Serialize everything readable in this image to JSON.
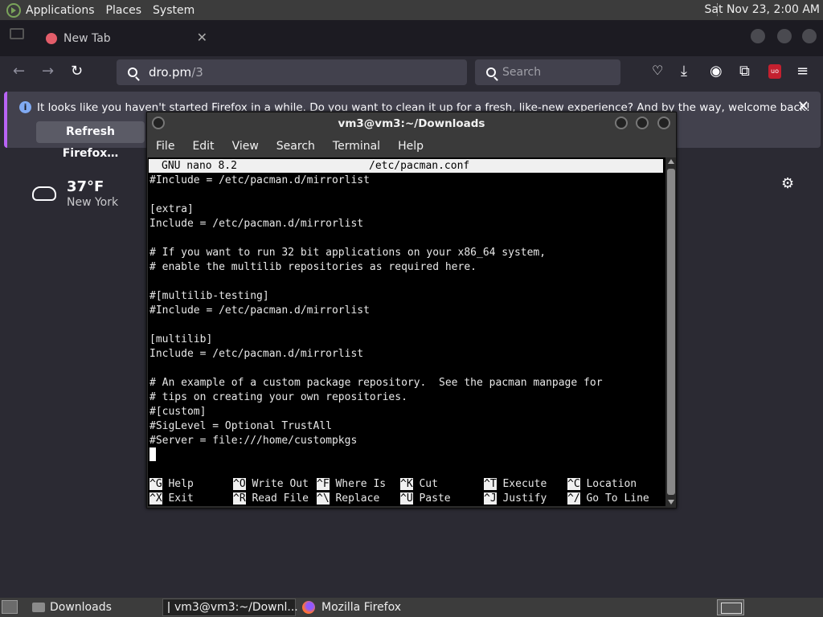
{
  "top_panel": {
    "menus": [
      "Applications",
      "Places",
      "System"
    ],
    "clock": "Sat Nov 23,  2:00 AM"
  },
  "browser": {
    "tab_title": "New Tab",
    "url_host": "dro.pm",
    "url_path": "/3",
    "search_placeholder": "Search",
    "notification": {
      "message": "It looks like you haven't started Firefox in a while. Do you want to clean it up for a fresh, like-new experience? And by the way, welcome back!",
      "button": "Refresh Firefox…"
    },
    "weather": {
      "temperature": "37°F",
      "city": "New York"
    }
  },
  "terminal": {
    "title": "vm3@vm3:~/Downloads",
    "menu": [
      "File",
      "Edit",
      "View",
      "Search",
      "Terminal",
      "Help"
    ],
    "nano_version": "GNU nano 8.2",
    "filename": "/etc/pacman.conf",
    "lines": [
      "#Include = /etc/pacman.d/mirrorlist",
      "",
      "[extra]",
      "Include = /etc/pacman.d/mirrorlist",
      "",
      "# If you want to run 32 bit applications on your x86_64 system,",
      "# enable the multilib repositories as required here.",
      "",
      "#[multilib-testing]",
      "#Include = /etc/pacman.d/mirrorlist",
      "",
      "[multilib]",
      "Include = /etc/pacman.d/mirrorlist",
      "",
      "# An example of a custom package repository.  See the pacman manpage for",
      "# tips on creating your own repositories.",
      "#[custom]",
      "#SigLevel = Optional TrustAll",
      "#Server = file:///home/custompkgs"
    ],
    "shortcuts": [
      {
        "key": "^G",
        "label": "Help"
      },
      {
        "key": "^O",
        "label": "Write Out"
      },
      {
        "key": "^F",
        "label": "Where Is"
      },
      {
        "key": "^K",
        "label": "Cut"
      },
      {
        "key": "^T",
        "label": "Execute"
      },
      {
        "key": "^C",
        "label": "Location"
      },
      {
        "key": "^X",
        "label": "Exit"
      },
      {
        "key": "^R",
        "label": "Read File"
      },
      {
        "key": "^\\",
        "label": "Replace"
      },
      {
        "key": "^U",
        "label": "Paste"
      },
      {
        "key": "^J",
        "label": "Justify"
      },
      {
        "key": "^/",
        "label": "Go To Line"
      }
    ]
  },
  "taskbar": {
    "items": [
      "Downloads",
      "vm3@vm3:~/Downl...",
      "Mozilla Firefox"
    ]
  }
}
